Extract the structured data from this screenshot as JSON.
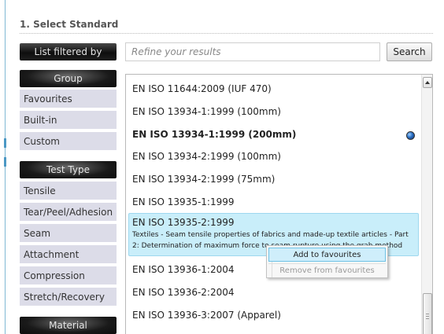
{
  "section": {
    "title": "1. Select Standard"
  },
  "filter": {
    "header": "List filtered by",
    "search_placeholder": "Refine your results",
    "search_button": "Search"
  },
  "sidebar": {
    "group_header": "Group",
    "group_items": [
      "Favourites",
      "Built-in",
      "Custom"
    ],
    "test_type_header": "Test Type",
    "test_type_items": [
      "Tensile",
      "Tear/Peel/Adhesion",
      "Seam",
      "Attachment",
      "Compression",
      "Stretch/Recovery"
    ],
    "material_header": "Material"
  },
  "standards": {
    "items": [
      "EN ISO 11644:2009 (IUF 470)",
      "EN ISO 13934-1:1999 (100mm)",
      "EN ISO 13934-1:1999 (200mm)",
      "EN ISO 13934-2:1999 (100mm)",
      "EN ISO 13934-2:1999 (75mm)",
      "EN ISO 13935-1:1999"
    ],
    "selected": {
      "title": "EN ISO 13935-2:1999",
      "description": "Textiles - Seam tensile properties of fabrics and made-up textile articles - Part 2: Determination of maximum force to seam rupture using the grab method"
    },
    "items_after": [
      "EN ISO 13936-1:2004",
      "EN ISO 13936-2:2004",
      "EN ISO 13936-3:2007 (Apparel)"
    ],
    "globe_icon": "globe-icon"
  },
  "context_menu": {
    "add": "Add to favourites",
    "remove": "Remove from favourites"
  },
  "colors": {
    "selected_row": "#c9eefa",
    "sidebar_item": "#dcdce8",
    "header_dark": "#111111"
  }
}
